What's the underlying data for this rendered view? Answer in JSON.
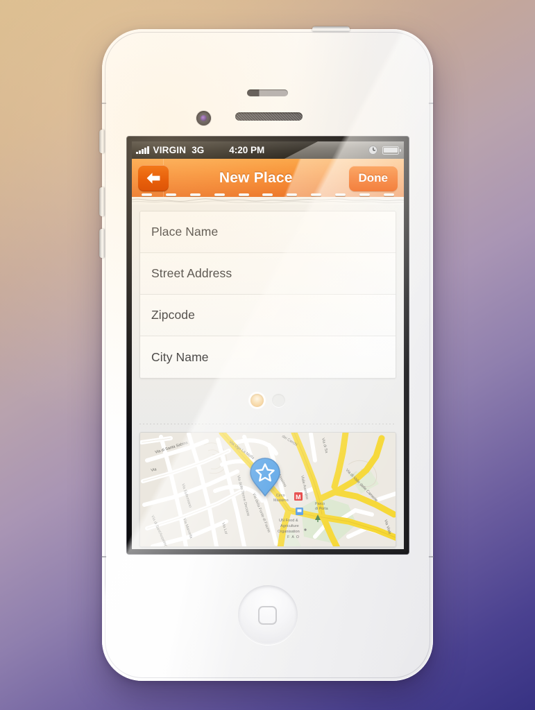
{
  "wallpaper": {
    "gradient_start": "#d9bb8d",
    "gradient_mid": "#a995b4",
    "gradient_end": "#373283"
  },
  "device": {
    "name": "white-smartphone",
    "hardware": {
      "camera": "front-camera",
      "proximity_sensor": "proximity-sensor",
      "earpiece": "earpiece-speaker",
      "home_button": "home-button",
      "power_button": "power-button",
      "silent_switch": "silent-switch",
      "volume_up": "volume-up-button",
      "volume_down": "volume-down-button"
    }
  },
  "status_bar": {
    "carrier": "VIRGIN",
    "network": "3G",
    "time": "4:20 PM",
    "signal_bars": 5,
    "icons": [
      "clock-icon",
      "battery-icon"
    ]
  },
  "nav_bar": {
    "title": "New Place",
    "back_label": "back-arrow-icon",
    "done_label": "Done",
    "background_color": "#f7831f",
    "perforation_count": 11
  },
  "form": {
    "fields": [
      {
        "label": "Place Name",
        "value": "",
        "placeholder": "Place Name"
      },
      {
        "label": "Street Address",
        "value": "",
        "placeholder": "Street Address"
      },
      {
        "label": "Zipcode",
        "value": "",
        "placeholder": "Zipcode"
      },
      {
        "label": "City Name",
        "value": "",
        "placeholder": "City Name"
      }
    ]
  },
  "pagination": {
    "total": 2,
    "current": 1,
    "active_color": "#eeb45c",
    "inactive_color": "#e4e4e2"
  },
  "map": {
    "pin_color": "#2e8ce0",
    "pin_icon": "star-pin-icon",
    "labels": [
      "Via di Santa Sabina",
      "Via Ugo La Malfa",
      "Via di Santa Sabina",
      "Via Eufemiano",
      "Via di Sant'Anselmo",
      "Via Marcella",
      "Via delle Terme Deciane",
      "Via della Fonte di Fauno",
      "Via Lor",
      "Viale Aventino",
      "Via dei Cerchi",
      "Via di Sa",
      "Via di Valle delle Camene",
      "Viale",
      "Circo Massimo",
      "Parco di Porta",
      "UN Food & Agriculture Organisation",
      "F A O",
      "Massimo",
      "po Massimo"
    ],
    "metro_label": "M",
    "metro_station": "Circo Massimo",
    "poi": [
      "Parco di Porta",
      "UN Food & Agriculture Organisation F A O"
    ]
  }
}
